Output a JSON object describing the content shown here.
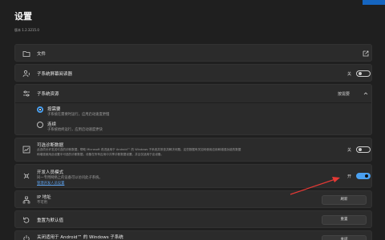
{
  "header": {
    "title": "设置",
    "version": "版本 1.2.3215.0"
  },
  "rows": {
    "files": {
      "title": "文件"
    },
    "browser": {
      "title": "子系统屏幕阅读器",
      "state": "关"
    },
    "resources": {
      "title": "子系统资源",
      "value": "按需要"
    },
    "opt_on_demand": {
      "title": "按需要",
      "sub": "子系统在需要时运行，应用启动速度更慢"
    },
    "opt_continuous": {
      "title": "连续",
      "sub": "子系统始终运行，应用启动速度更快"
    },
    "diagnostics": {
      "title": "可选诊断数据",
      "sub1": "此选项允许发送可选的诊断数据，帮助 Microsoft 改进适用于 Android™ 的 Windows 子系统并排查并解决问题。这些数据有关如何使用应用和增强功能的数据",
      "sub2": "和增强使用此设置中可选的诊断数据。设备在所有应用中共享诊断数据设置，并且仅适用于此设备。",
      "state": "关"
    },
    "developer": {
      "title": "开发人员模式",
      "sub": "同一专用网络上的设备可以访问此子系统。",
      "link": "管理开发人员设置",
      "state": "开"
    },
    "ip": {
      "title": "IP 地址",
      "sub": "不可用",
      "button": "刷新"
    },
    "reset": {
      "title": "重置为默认值",
      "button": "重置"
    },
    "shutdown": {
      "title": "关闭适用于 Android™ 的 Windows 子系统",
      "button": "关闭"
    }
  },
  "colors": {
    "accent": "#4aa0f0",
    "arrow": "#e53935"
  }
}
